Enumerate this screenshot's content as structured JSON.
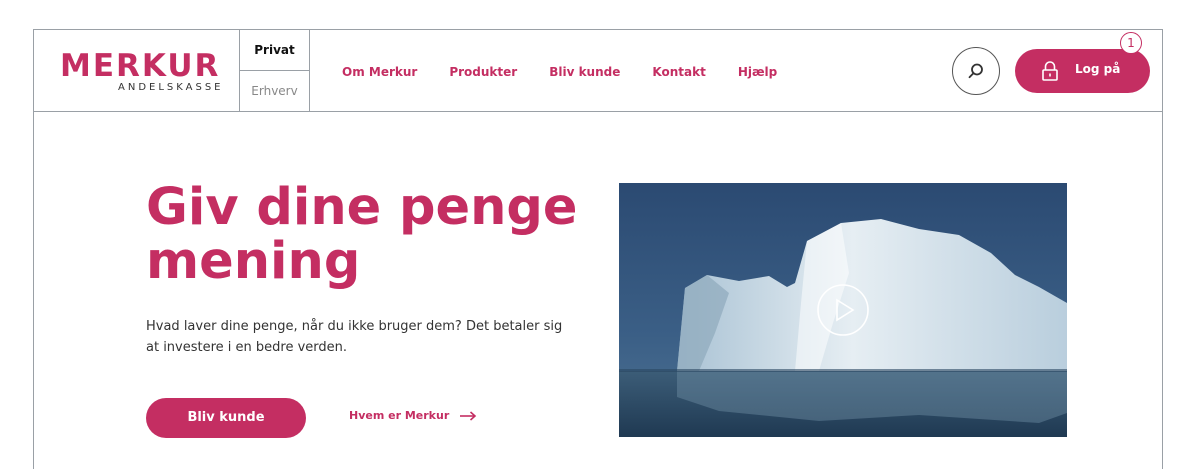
{
  "brand": {
    "name": "MERKUR",
    "subtitle": "ANDELSKASSE"
  },
  "segments": {
    "private": "Privat",
    "business": "Erhverv"
  },
  "nav": {
    "items": [
      "Om Merkur",
      "Produkter",
      "Bliv kunde",
      "Kontakt",
      "Hjælp"
    ]
  },
  "header": {
    "search_icon": "search-icon",
    "login_label": "Log på",
    "login_icon": "lock-icon",
    "badge": "1"
  },
  "hero": {
    "headline": "Giv dine penge mening",
    "intro": "Hvad laver dine penge, når du ikke bruger dem? Det betaler sig at investere i en bedre verden.",
    "primary_cta": "Bliv kunde",
    "secondary_link": "Hvem er Merkur",
    "video_icon": "play-icon"
  },
  "colors": {
    "accent": "#c42e62",
    "border": "#9aa0a6"
  }
}
